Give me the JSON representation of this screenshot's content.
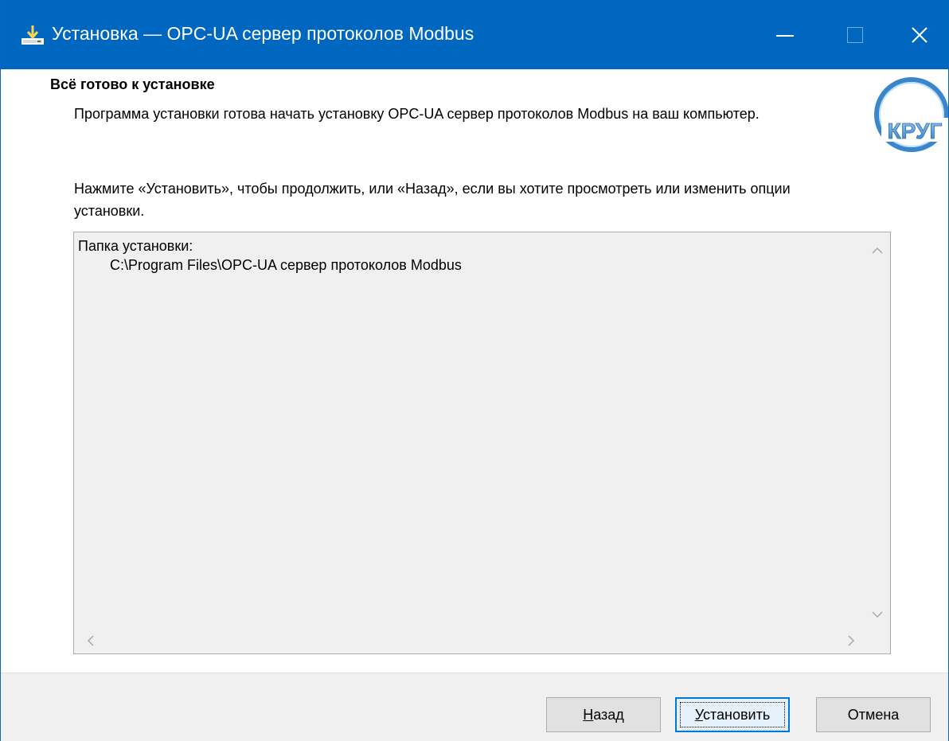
{
  "window": {
    "title": "Установка — OPC-UA сервер протоколов Modbus",
    "accent_color": "#0067c0"
  },
  "header": {
    "title": "Всё готово к установке",
    "description": "Программа установки готова начать установку OPC-UA сервер протоколов Modbus на ваш компьютер.",
    "logo_text": "КРУГ"
  },
  "main": {
    "info": "Нажмите «Установить», чтобы продолжить, или «Назад», если вы хотите просмотреть или изменить опции установки.",
    "memo": {
      "line1": "Папка установки:",
      "line2": "C:\\Program Files\\OPC-UA сервер протоколов Modbus"
    }
  },
  "buttons": {
    "back": "Назад",
    "install": "Установить",
    "cancel": "Отмена"
  },
  "icons": {
    "title": "installer-download-icon",
    "minimize": "minimize-icon",
    "maximize": "maximize-icon",
    "close": "close-icon"
  }
}
